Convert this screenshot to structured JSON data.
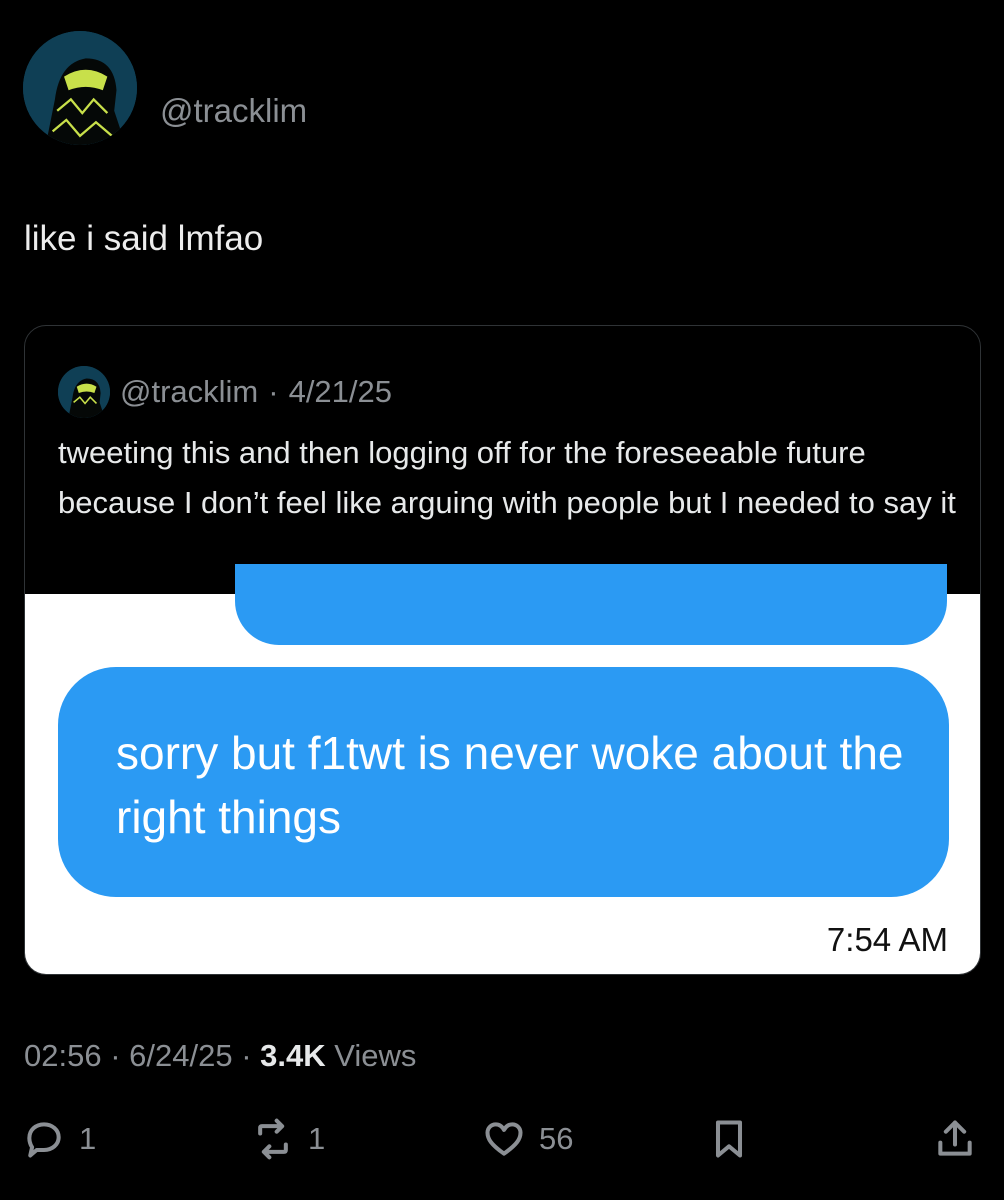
{
  "author": {
    "handle": "@tracklim"
  },
  "tweet": {
    "text": "like i said lmfao"
  },
  "quoted": {
    "handle": "@tracklim",
    "separator": "·",
    "date": "4/21/25",
    "text": "tweeting this and then logging off for the foreseeable future because I don’t feel like arguing with people but I needed to say it",
    "image": {
      "message_text": "sorry but f1twt is never woke about the right things",
      "message_time": "7:54 AM",
      "bubble_color": "#2b9af3"
    }
  },
  "meta": {
    "time": "02:56",
    "sep1": " · ",
    "date": "6/24/25",
    "sep2": " · ",
    "views_count": "3.4K",
    "views_label": " Views"
  },
  "actions": {
    "replies": "1",
    "reposts": "1",
    "likes": "56"
  }
}
